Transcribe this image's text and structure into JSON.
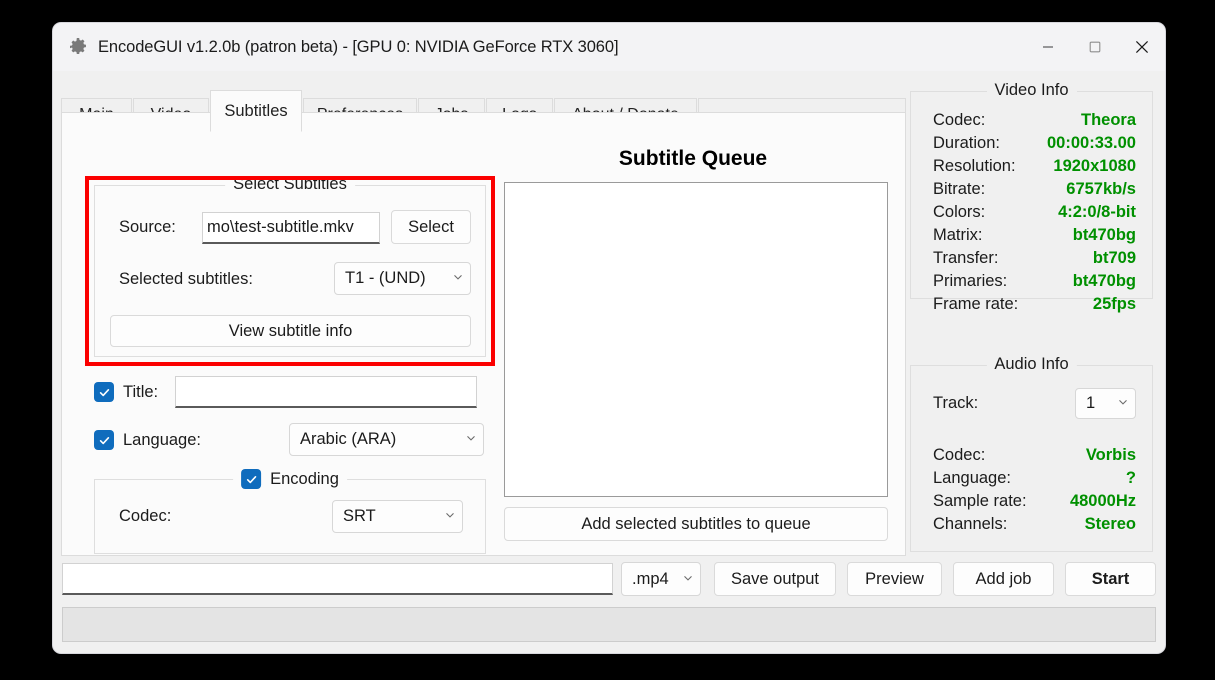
{
  "window": {
    "title": "EncodeGUI v1.2.0b (patron beta) - [GPU 0: NVIDIA GeForce RTX 3060]",
    "app_icon": "gear-icon",
    "controls": {
      "minimize": "minimize-icon",
      "maximize": "maximize-icon",
      "close": "close-icon"
    }
  },
  "tabs": [
    {
      "label": "Main",
      "active": false
    },
    {
      "label": "Video",
      "active": false
    },
    {
      "label": "Subtitles",
      "active": true
    },
    {
      "label": "Preferences",
      "active": false
    },
    {
      "label": "Jobs",
      "active": false
    },
    {
      "label": "Logs",
      "active": false
    },
    {
      "label": "About / Donate",
      "active": false
    }
  ],
  "highlight": {
    "color": "#fb0000",
    "target": "select-subtitles-group"
  },
  "select_subtitles": {
    "group_title": "Select Subtitles",
    "source_label": "Source:",
    "source_value": "mo\\test-subtitle.mkv",
    "select_button": "Select",
    "selected_subtitles_label": "Selected subtitles:",
    "selected_subtitles_value": "T1 - (UND)",
    "view_info_button": "View subtitle info"
  },
  "options": {
    "title_label": "Title:",
    "title_value": "",
    "title_checked": true,
    "language_label": "Language:",
    "language_value": "Arabic (ARA)",
    "language_checked": true,
    "encoding_label": "Encoding",
    "encoding_checked": true,
    "codec_label": "Codec:",
    "codec_value": "SRT"
  },
  "queue": {
    "heading": "Subtitle Queue",
    "items": [],
    "add_button": "Add selected subtitles to queue"
  },
  "video_info": {
    "group_title": "Video Info",
    "value_color": "#009000",
    "rows": [
      {
        "key": "Codec:",
        "value": "Theora"
      },
      {
        "key": "Duration:",
        "value": "00:00:33.00"
      },
      {
        "key": "Resolution:",
        "value": "1920x1080"
      },
      {
        "key": "Bitrate:",
        "value": "6757kb/s"
      },
      {
        "key": "Colors:",
        "value": "4:2:0/8-bit"
      },
      {
        "key": "Matrix:",
        "value": "bt470bg"
      },
      {
        "key": "Transfer:",
        "value": "bt709"
      },
      {
        "key": "Primaries:",
        "value": "bt470bg"
      },
      {
        "key": "Frame rate:",
        "value": "25fps"
      }
    ]
  },
  "audio_info": {
    "group_title": "Audio Info",
    "track_label": "Track:",
    "track_value": "1",
    "rows": [
      {
        "key": "Codec:",
        "value": "Vorbis"
      },
      {
        "key": "Language:",
        "value": "?"
      },
      {
        "key": "Sample rate:",
        "value": "48000Hz"
      },
      {
        "key": "Channels:",
        "value": "Stereo"
      }
    ]
  },
  "bottom": {
    "output_path": "",
    "container_value": ".mp4",
    "save_output": "Save output",
    "preview": "Preview",
    "add_job": "Add job",
    "start": "Start",
    "status_text": ""
  }
}
